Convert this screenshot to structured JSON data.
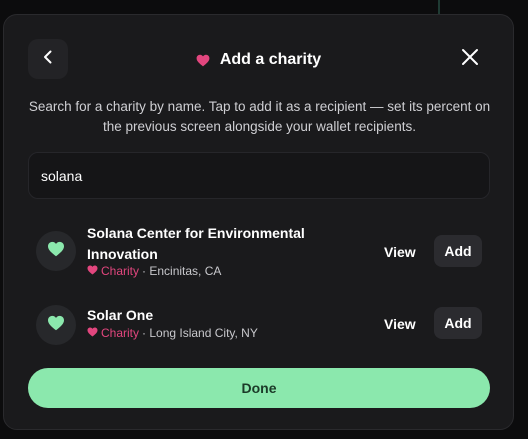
{
  "header": {
    "title": "Add a charity",
    "back_icon": "chevron-left-icon",
    "close_icon": "close-icon",
    "title_icon": "heart-icon"
  },
  "description": "Search for a charity by name. Tap to add it as a recipient — set its percent on the previous screen alongside your wallet recipients.",
  "search": {
    "value": "solana",
    "placeholder": ""
  },
  "results": [
    {
      "name": "Solana Center for Environmental Innovation",
      "category": "Charity",
      "location": "· Encinitas, CA",
      "view_label": "View",
      "add_label": "Add"
    },
    {
      "name": "Solar One",
      "category": "Charity",
      "location": "· Long Island City, NY",
      "view_label": "View",
      "add_label": "Add"
    }
  ],
  "done_label": "Done",
  "colors": {
    "accent_pink": "#e2467e",
    "accent_green": "#8be8ad",
    "avatar_heart": "#8be8ad",
    "modal_bg": "#1a1a1c"
  }
}
